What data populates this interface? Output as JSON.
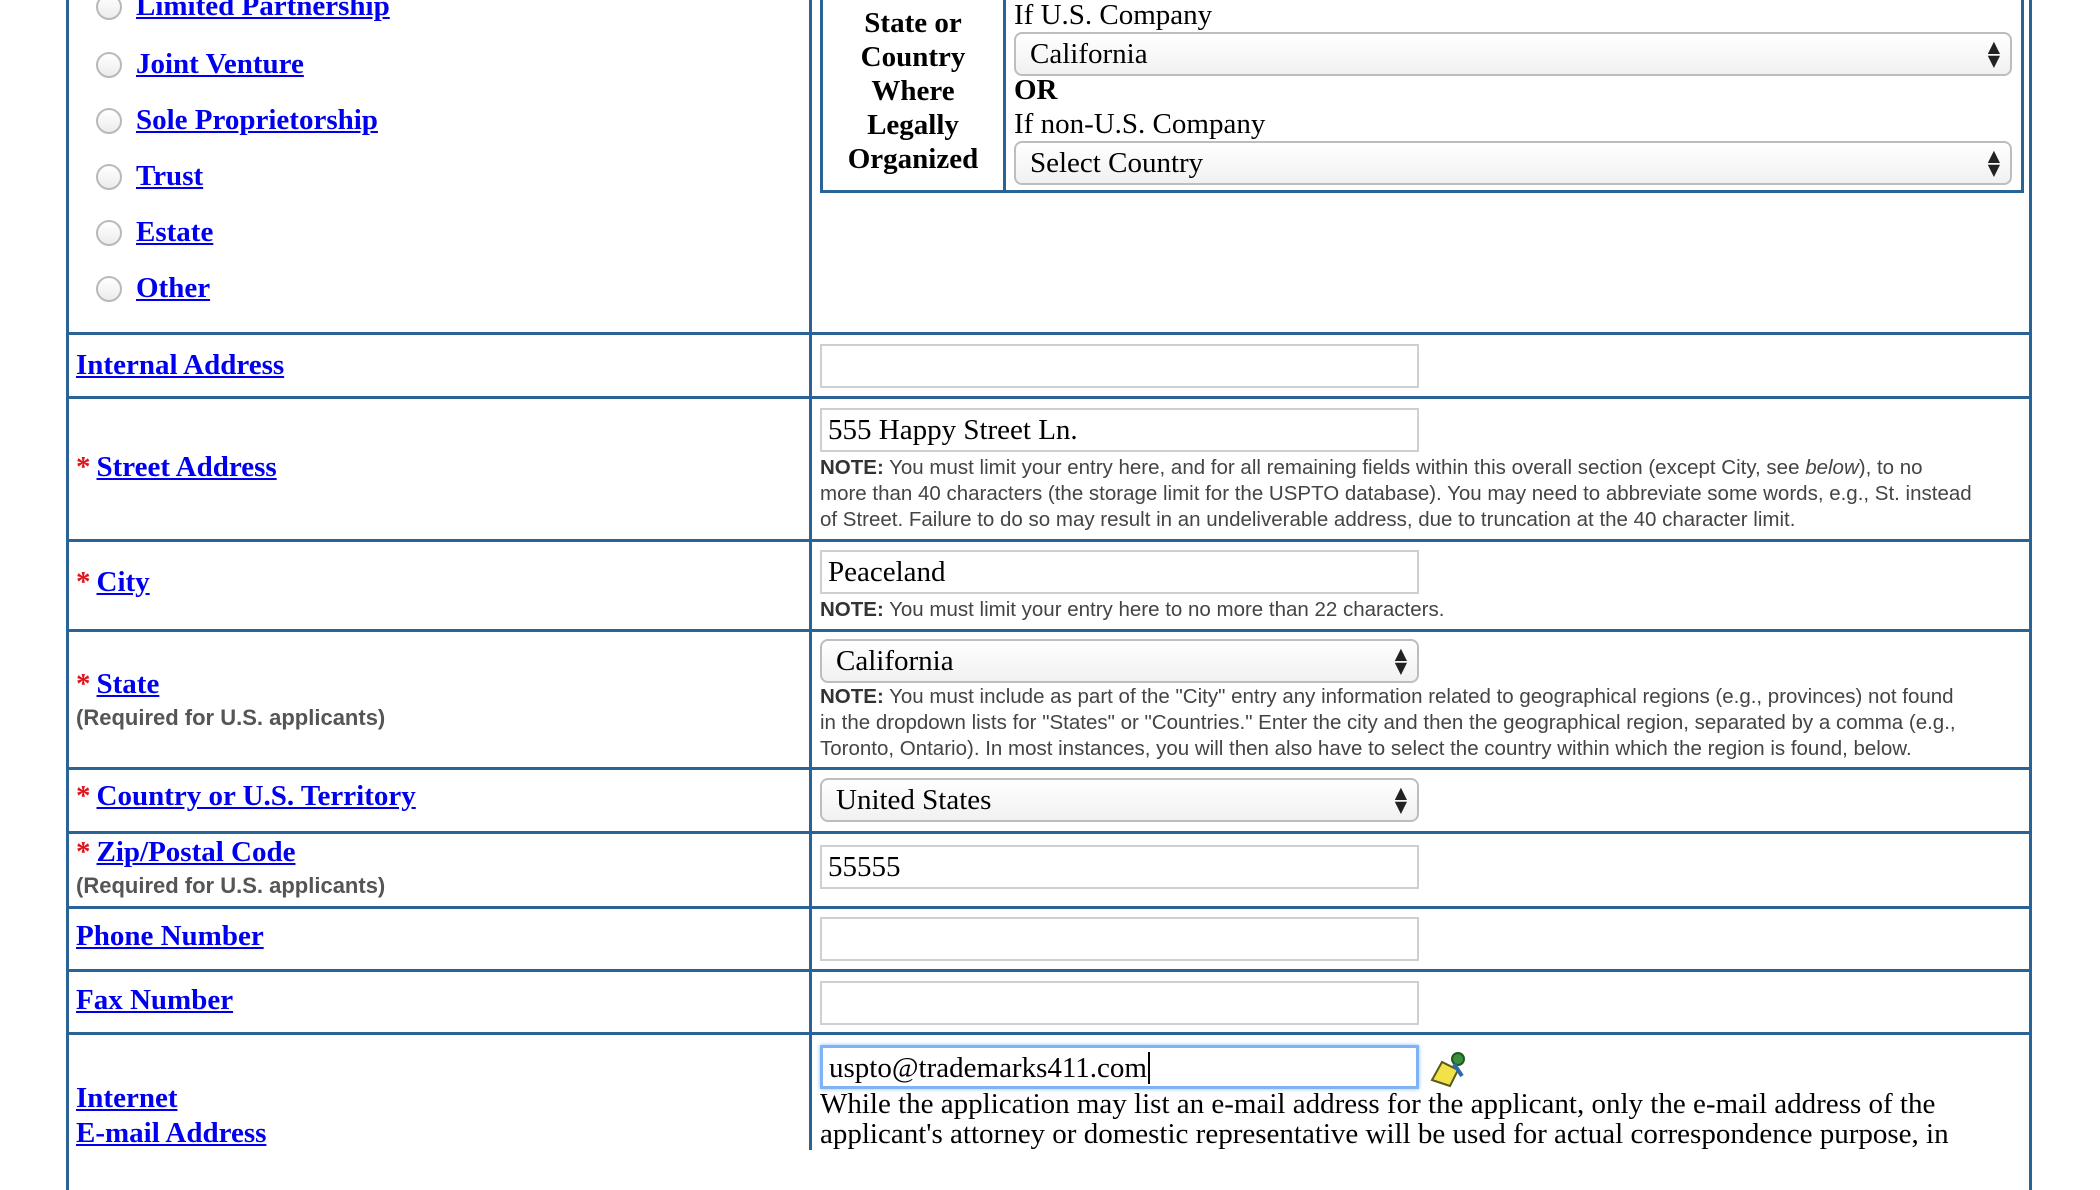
{
  "entity_types": [
    "Limited Partnership",
    "Joint Venture",
    "Sole Proprietorship",
    "Trust",
    "Estate",
    "Other"
  ],
  "legal_org": {
    "header_line1": "State or",
    "header_line2": "Country",
    "header_line3": "Where",
    "header_line4": "Legally",
    "header_line5": "Organized",
    "us_label": "If U.S. Company",
    "us_value": "California",
    "or_label": "OR",
    "nonus_label": "If non-U.S. Company",
    "nonus_value": "Select Country"
  },
  "fields": {
    "internal_address": {
      "label": "Internal Address",
      "value": ""
    },
    "street": {
      "label": "Street Address",
      "value": "555 Happy Street Ln.",
      "note_prefix": "NOTE:",
      "note_line1": " You must limit your entry here, and for all remaining fields within this overall section (except City, see ",
      "note_below": "below",
      "note_line1b": "), to no",
      "note_line2": "more than 40 characters (the storage limit for the USPTO database). You may need to abbreviate some words, e.g., St. instead",
      "note_line3": "of Street. Failure to do so may result in an undeliverable address, due to truncation at the 40 character limit."
    },
    "city": {
      "label": "City",
      "value": "Peaceland",
      "note_prefix": "NOTE:",
      "note": " You must limit your entry here to no more than 22 characters."
    },
    "state": {
      "label": "State",
      "sub": "(Required for U.S. applicants)",
      "value": "California",
      "note_prefix": "NOTE:",
      "note_line1": " You must include as part of the \"City\" entry any information related to geographical regions (e.g., provinces) not found",
      "note_line2": "in the dropdown lists for \"States\" or \"Countries.\" Enter the city and then the geographical region, separated by a comma (e.g.,",
      "note_line3": "Toronto, Ontario). In most instances, you will then also have to select the country within which the region is found, below."
    },
    "country": {
      "label": "Country or U.S. Territory",
      "value": "United States"
    },
    "zip": {
      "label": "Zip/Postal Code",
      "sub": "(Required for U.S. applicants)",
      "value": "55555"
    },
    "phone": {
      "label": "Phone Number",
      "value": ""
    },
    "fax": {
      "label": "Fax Number",
      "value": ""
    },
    "email": {
      "label_line1": "Internet",
      "label_line2": "E-mail Address",
      "value": "uspto@trademarks411.com",
      "help_line1": "While the application may list an e-mail address for the applicant, only the e-mail address of the",
      "help_line2": "applicant's attorney or domestic representative will be used for actual correspondence purpose, in"
    }
  },
  "required_marker": "*"
}
